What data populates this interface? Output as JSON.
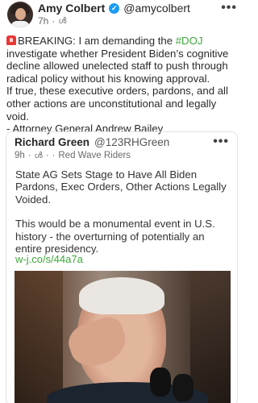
{
  "post": {
    "author_name": "Amy Colbert",
    "handle": "@amycolbert",
    "time": "7h",
    "separator": "·",
    "more_label": "•••",
    "body_prefix": "BREAKING: I am demanding the ",
    "hashtag": "#DOJ",
    "body_rest": " investigate whether President Biden’s cognitive decline allowed unelected staff to push through radical policy without his knowing approval.",
    "body_line2": "If true, these executive orders, pardons, and all other actions are unconstitutional and legally void.",
    "body_line3": "- Attorney General Andrew Bailey"
  },
  "quote": {
    "author_name": "Richard Green",
    "handle": "@123RHGreen",
    "time": "9h",
    "separator": "·",
    "group": "Red Wave Riders",
    "more_label": "•••",
    "paragraph1": "State AG Sets Stage to Have All Biden Pardons, Exec Orders, Other Actions Legally Voided.",
    "paragraph2": "This would be a monumental event in U.S. history - the overturning of potentially an entire presidency.",
    "link": "w-j.co/s/44a7a"
  },
  "colors": {
    "accent_green": "#3ea83a",
    "verified_blue": "#1d9bf0",
    "siren_red": "#e53935"
  },
  "icons": {
    "verified": "verified-check-icon",
    "audience": "audience-icon",
    "siren": "siren-icon"
  }
}
